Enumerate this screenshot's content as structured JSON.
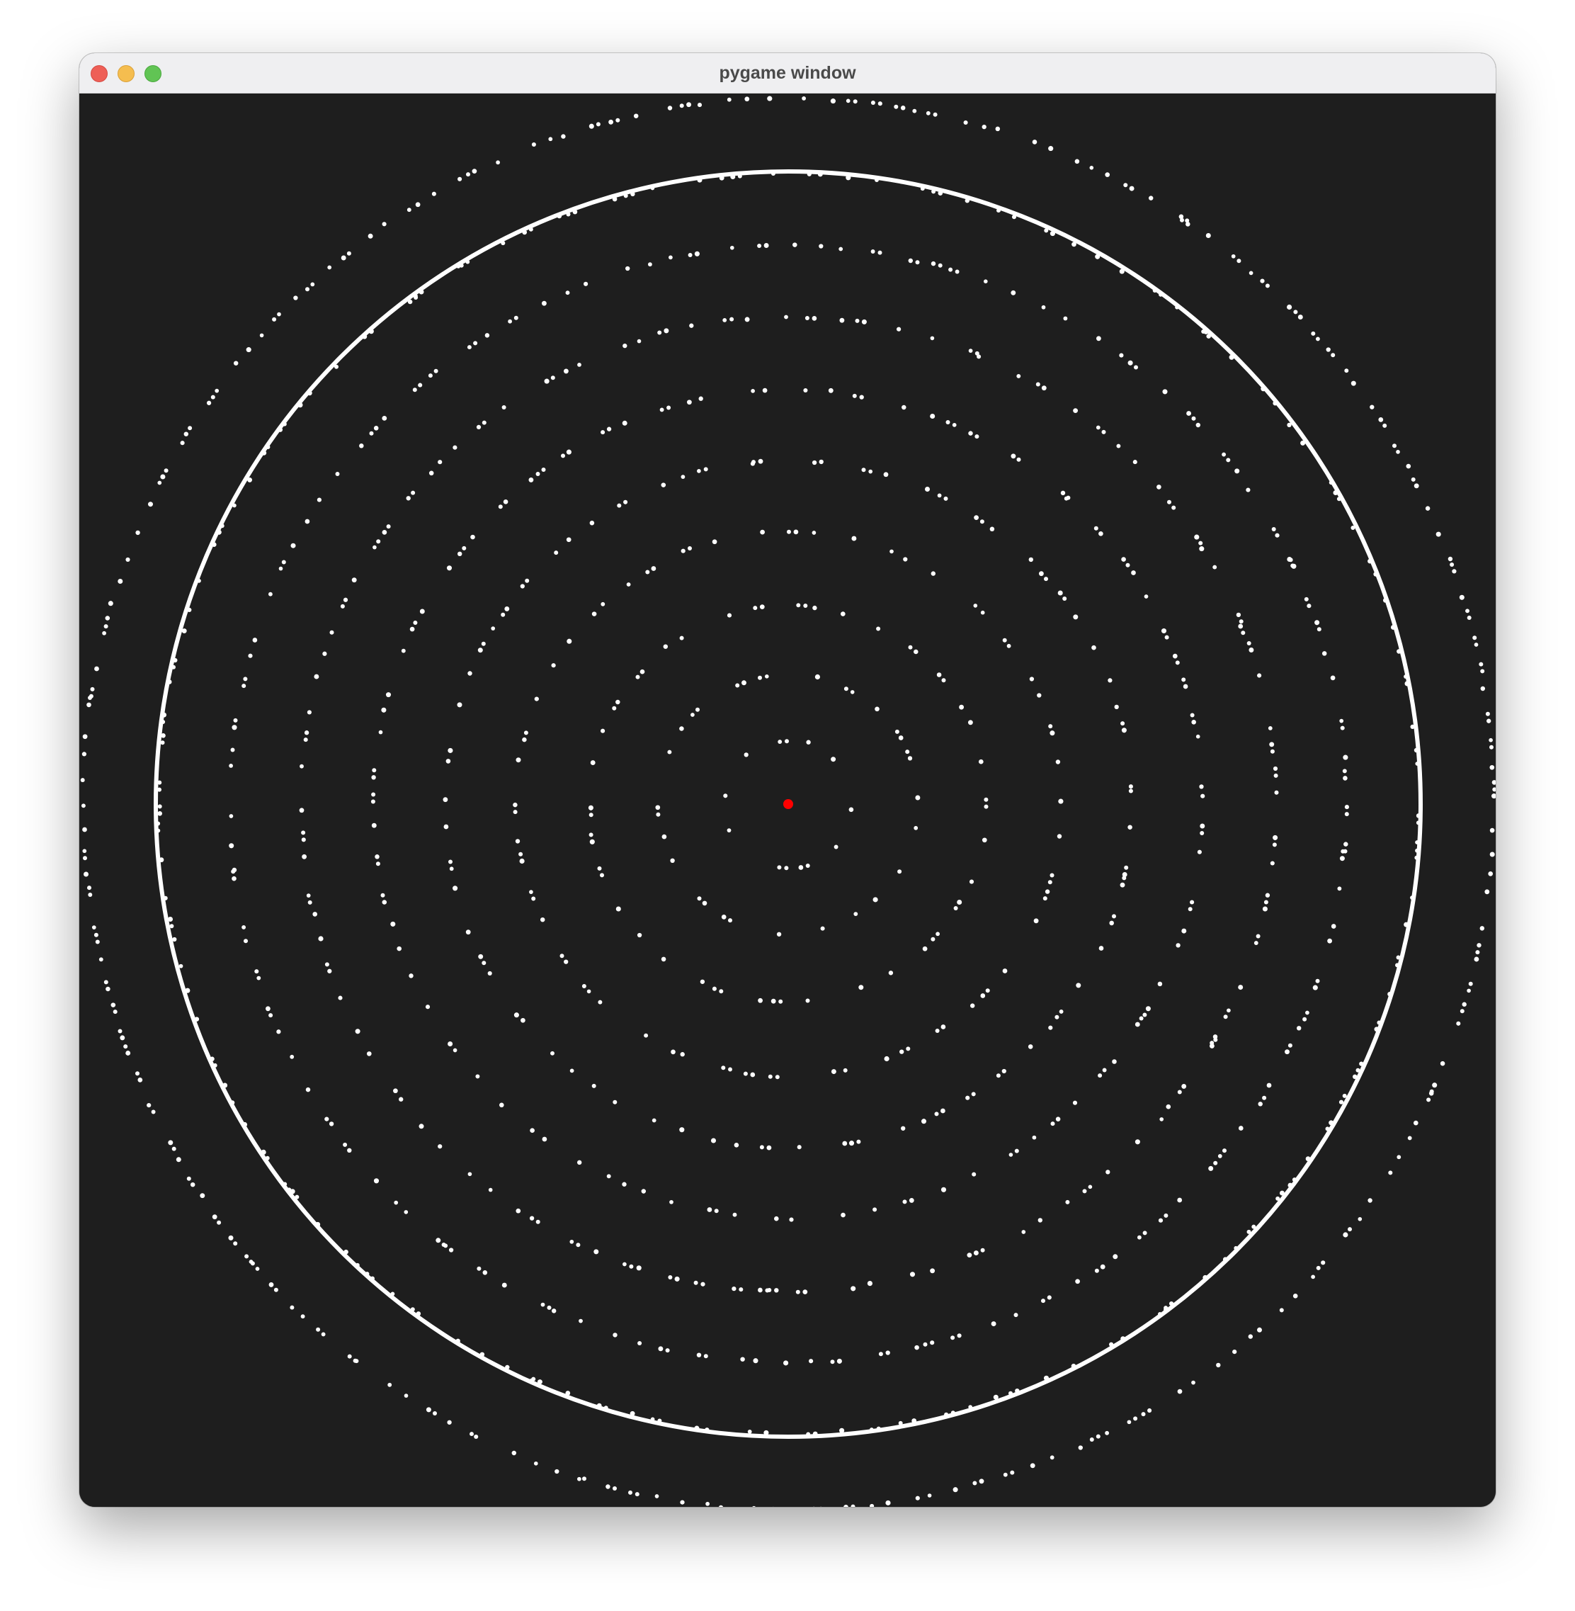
{
  "window": {
    "title": "pygame window"
  },
  "colors": {
    "background": "#1e1e1e",
    "particle": "#ffffff",
    "center_point": "#ff0000"
  },
  "scene": {
    "rings": [
      {
        "name": "ring-1",
        "count": 10,
        "solid": false
      },
      {
        "name": "ring-2",
        "count": 22,
        "solid": false
      },
      {
        "name": "ring-3",
        "count": 36,
        "solid": false
      },
      {
        "name": "ring-4",
        "count": 52,
        "solid": false
      },
      {
        "name": "ring-5",
        "count": 70,
        "solid": false
      },
      {
        "name": "ring-6",
        "count": 86,
        "solid": false
      },
      {
        "name": "ring-7",
        "count": 104,
        "solid": false
      },
      {
        "name": "ring-8",
        "count": 120,
        "solid": false
      },
      {
        "name": "ring-9",
        "count": 138,
        "solid": false
      },
      {
        "name": "ring-10",
        "count": 0,
        "solid": true
      },
      {
        "name": "ring-11",
        "count": 190,
        "solid": false
      }
    ]
  }
}
